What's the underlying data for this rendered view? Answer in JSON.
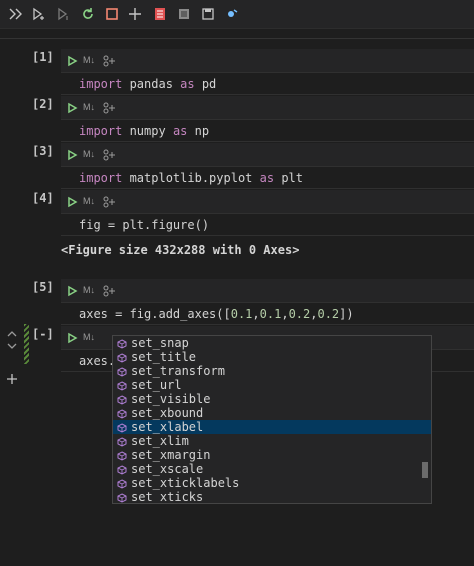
{
  "toolbar": {
    "buttons": [
      {
        "name": "run-all-icon"
      },
      {
        "name": "run-above-icon"
      },
      {
        "name": "run-below-icon"
      },
      {
        "name": "restart-icon"
      },
      {
        "name": "interrupt-icon"
      },
      {
        "name": "add-icon"
      },
      {
        "name": "clear-outputs-icon"
      },
      {
        "name": "variables-icon"
      },
      {
        "name": "save-icon"
      },
      {
        "name": "debug-icon"
      }
    ]
  },
  "cells": [
    {
      "number": "[1]",
      "badge": "M↓",
      "code_parts": [
        {
          "t": "kw",
          "v": "import"
        },
        {
          "t": "p",
          "v": " pandas "
        },
        {
          "t": "kw",
          "v": "as"
        },
        {
          "t": "p",
          "v": " pd"
        }
      ]
    },
    {
      "number": "[2]",
      "badge": "M↓",
      "code_parts": [
        {
          "t": "kw",
          "v": "import"
        },
        {
          "t": "p",
          "v": " numpy "
        },
        {
          "t": "kw",
          "v": "as"
        },
        {
          "t": "p",
          "v": " np"
        }
      ]
    },
    {
      "number": "[3]",
      "badge": "M↓",
      "code_parts": [
        {
          "t": "kw",
          "v": "import"
        },
        {
          "t": "p",
          "v": " matplotlib.pyplot "
        },
        {
          "t": "kw",
          "v": "as"
        },
        {
          "t": "p",
          "v": " plt"
        }
      ]
    },
    {
      "number": "[4]",
      "badge": "M↓",
      "code_parts": [
        {
          "t": "p",
          "v": "fig = plt.figure()"
        }
      ],
      "output": "<Figure size 432x288 with 0 Axes>"
    },
    {
      "number": "[5]",
      "badge": "M↓",
      "code_parts": [
        {
          "t": "p",
          "v": "axes = fig.add_axes(["
        },
        {
          "t": "num",
          "v": "0.1"
        },
        {
          "t": "p",
          "v": ","
        },
        {
          "t": "num",
          "v": "0.1"
        },
        {
          "t": "p",
          "v": ","
        },
        {
          "t": "num",
          "v": "0.2"
        },
        {
          "t": "p",
          "v": ","
        },
        {
          "t": "num",
          "v": "0.2"
        },
        {
          "t": "p",
          "v": "])"
        }
      ]
    },
    {
      "number": "[-]",
      "badge": "M↓",
      "code_parts": [
        {
          "t": "p",
          "v": "axes."
        }
      ]
    }
  ],
  "suggestions": {
    "items": [
      "set_snap",
      "set_title",
      "set_transform",
      "set_url",
      "set_visible",
      "set_xbound",
      "set_xlabel",
      "set_xlim",
      "set_xmargin",
      "set_xscale",
      "set_xticklabels",
      "set_xticks"
    ],
    "selected_index": 6
  },
  "colors": {
    "accent_run": "#89d185",
    "keyword": "#c586c0",
    "number": "#b5cea8",
    "method_icon": "#b180d7"
  }
}
